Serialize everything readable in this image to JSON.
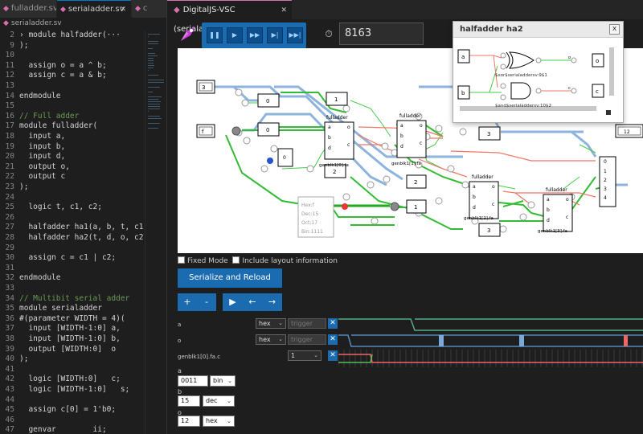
{
  "editor": {
    "tabs": [
      {
        "label": "fulladder.sv"
      },
      {
        "label": "serialadder.sv"
      },
      {
        "label": "c"
      }
    ],
    "breadcrumb": "serialadder.sv",
    "lines": [
      {
        "num": "2",
        "text": "› module halfadder(···"
      },
      {
        "num": "9",
        "text": ");"
      },
      {
        "num": "10",
        "text": ""
      },
      {
        "num": "11",
        "text": "  assign o = a ^ b;"
      },
      {
        "num": "12",
        "text": "  assign c = a & b;"
      },
      {
        "num": "13",
        "text": ""
      },
      {
        "num": "14",
        "text": "endmodule"
      },
      {
        "num": "15",
        "text": ""
      },
      {
        "num": "16",
        "text": "// Full adder",
        "comment": true
      },
      {
        "num": "17",
        "text": "module fulladder("
      },
      {
        "num": "18",
        "text": "  input a,"
      },
      {
        "num": "19",
        "text": "  input b,"
      },
      {
        "num": "20",
        "text": "  input d,"
      },
      {
        "num": "21",
        "text": "  output o,"
      },
      {
        "num": "22",
        "text": "  output c"
      },
      {
        "num": "23",
        "text": ");"
      },
      {
        "num": "24",
        "text": ""
      },
      {
        "num": "25",
        "text": "  logic t, c1, c2;"
      },
      {
        "num": "26",
        "text": ""
      },
      {
        "num": "27",
        "text": "  halfadder ha1(a, b, t, c1)"
      },
      {
        "num": "28",
        "text": "  halfadder ha2(t, d, o, c2)"
      },
      {
        "num": "29",
        "text": ""
      },
      {
        "num": "30",
        "text": "  assign c = c1 | c2;"
      },
      {
        "num": "31",
        "text": ""
      },
      {
        "num": "32",
        "text": "endmodule"
      },
      {
        "num": "33",
        "text": ""
      },
      {
        "num": "34",
        "text": "// Multibit serial adder",
        "comment": true
      },
      {
        "num": "35",
        "text": "module serialadder"
      },
      {
        "num": "36",
        "text": "#(parameter WIDTH = 4)("
      },
      {
        "num": "37",
        "text": "  input [WIDTH-1:0] a,"
      },
      {
        "num": "38",
        "text": "  input [WIDTH-1:0] b,"
      },
      {
        "num": "39",
        "text": "  output [WIDTH:0]  o"
      },
      {
        "num": "40",
        "text": ");"
      },
      {
        "num": "41",
        "text": ""
      },
      {
        "num": "42",
        "text": "  logic [WIDTH:0]   c;"
      },
      {
        "num": "43",
        "text": "  logic [WIDTH-1:0]   s;"
      },
      {
        "num": "44",
        "text": ""
      },
      {
        "num": "45",
        "text": "  assign c[0] = 1'b0;"
      },
      {
        "num": "46",
        "text": ""
      },
      {
        "num": "47",
        "text": "  genvar        ii;"
      }
    ]
  },
  "viewer": {
    "tab_label": "DigitalJS-VSC (serialadder.sv)",
    "tick_value": "8163",
    "fixed_mode_label": "Fixed Mode",
    "layout_info_label": "Include layout information",
    "serialize_label": "Serialize and Reload",
    "zoom_in": "+",
    "zoom_out": "-",
    "play": "▶",
    "step_back": "←",
    "step_forward": "→"
  },
  "circuit": {
    "inputs": {
      "a": "3",
      "b": "f"
    },
    "output": "12",
    "consts": [
      "0",
      "0",
      "0",
      "1",
      "2",
      "3",
      "3",
      "2",
      "1"
    ],
    "units": [
      {
        "label": "fulladder",
        "name": "genblk1[0].fa"
      },
      {
        "label": "fulladder",
        "name": "genblk1[1].fa"
      },
      {
        "label": "fulladder",
        "name": "genblk1[2].fa"
      },
      {
        "label": "fulladder",
        "name": "genblk1[3].fa"
      }
    ],
    "port_labels": {
      "a": "a",
      "b": "b",
      "d": "d",
      "o": "o",
      "c": "c"
    },
    "concat_labels": [
      "0",
      "1",
      "2",
      "3",
      "4"
    ],
    "tooltip": [
      "Hex:f",
      "Dec:15",
      "Oct:17",
      "Bin:1111"
    ]
  },
  "popup": {
    "title": "halfadder ha2",
    "close": "x",
    "xor_label": "$xor$serialaddersv:9$1",
    "and_label": "$and$serialaddersv:10$2",
    "in_a": "a",
    "in_b": "b",
    "out_o": "o",
    "out_c": "c"
  },
  "waveform": {
    "rows": [
      {
        "label": "a",
        "format": "hex",
        "trigger": "trigger"
      },
      {
        "label": "o",
        "format": "hex",
        "trigger": "trigger"
      },
      {
        "label": "genblk1[0].fa.c",
        "format": "1"
      }
    ]
  },
  "fields": {
    "a": {
      "label": "a",
      "value": "0011",
      "format": "bin"
    },
    "b": {
      "label": "b",
      "value": "15",
      "format": "dec"
    },
    "o": {
      "label": "o",
      "value": "12",
      "format": "hex"
    }
  },
  "colors": {
    "accent": "#1a6bb0",
    "wire_on": "#22bb22",
    "wire_off": "#ee6644",
    "bus": "#6f9fce"
  }
}
